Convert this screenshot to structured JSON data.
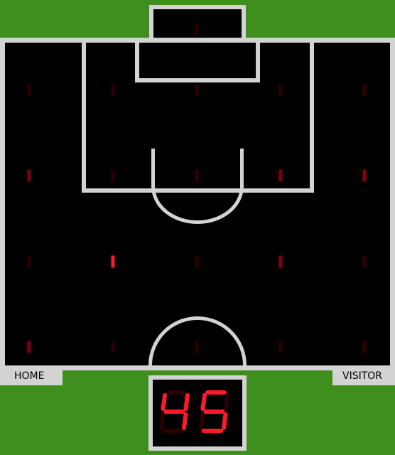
{
  "teams": {
    "home": "HOME",
    "visitor": "VISITOR"
  },
  "score": "45",
  "colors": {
    "field": "#000000",
    "grass": "#3f8f1f",
    "lines": "#d3d3d3",
    "blip_on": "#ff1a2a",
    "blip_dim": "#800010",
    "blip_off": "#2a0000"
  },
  "blips": [
    {
      "row": 0,
      "col": 2,
      "state": "off"
    },
    {
      "row": 1,
      "col": 0,
      "state": "off"
    },
    {
      "row": 1,
      "col": 1,
      "state": "off"
    },
    {
      "row": 1,
      "col": 2,
      "state": "off"
    },
    {
      "row": 1,
      "col": 3,
      "state": "off"
    },
    {
      "row": 1,
      "col": 4,
      "state": "off"
    },
    {
      "row": 2,
      "col": 0,
      "state": "dim"
    },
    {
      "row": 2,
      "col": 1,
      "state": "off"
    },
    {
      "row": 2,
      "col": 2,
      "state": "off"
    },
    {
      "row": 2,
      "col": 3,
      "state": "dim"
    },
    {
      "row": 2,
      "col": 4,
      "state": "dim"
    },
    {
      "row": 3,
      "col": 0,
      "state": "off"
    },
    {
      "row": 3,
      "col": 1,
      "state": "on"
    },
    {
      "row": 3,
      "col": 2,
      "state": "off"
    },
    {
      "row": 3,
      "col": 3,
      "state": "dim"
    },
    {
      "row": 3,
      "col": 4,
      "state": "off"
    },
    {
      "row": 4,
      "col": 0,
      "state": "dim"
    },
    {
      "row": 4,
      "col": 1,
      "state": "off"
    },
    {
      "row": 4,
      "col": 2,
      "state": "off"
    },
    {
      "row": 4,
      "col": 3,
      "state": "off"
    },
    {
      "row": 4,
      "col": 4,
      "state": "off"
    }
  ]
}
